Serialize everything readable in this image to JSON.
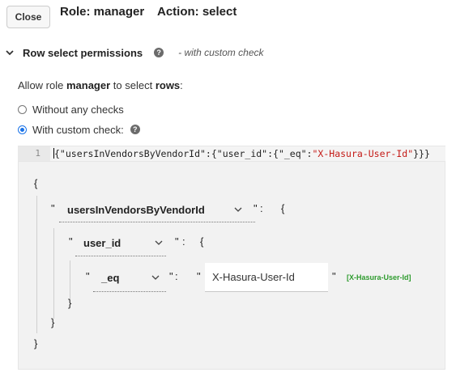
{
  "header": {
    "close_label": "Close",
    "role_text": "Role: manager",
    "action_text": "Action: select"
  },
  "section": {
    "title": "Row select permissions",
    "help_icon": "?",
    "note": "- with custom check"
  },
  "allow": {
    "prefix": "Allow role ",
    "role": "manager",
    "middle": " to select ",
    "target": "rows",
    "suffix": ":"
  },
  "options": [
    {
      "label": "Without any checks",
      "selected": false
    },
    {
      "label": "With custom check:",
      "selected": true
    }
  ],
  "code": {
    "line_number": "1",
    "part1": "{\"usersInVendorsByVendorId\":{\"user_id\":{\"_eq\":",
    "string_value": "\"X-Hasura-User-Id\"",
    "part2": "}}}"
  },
  "builder": {
    "open_brace": "{",
    "close_brace": "}",
    "quote": "\"",
    "colon": ":",
    "level1_key": "usersInVendorsByVendorId",
    "level2_key": "user_id",
    "level3_key": "_eq",
    "value": "X-Hasura-User-Id",
    "value_hint": "[X-Hasura-User-Id]"
  },
  "colors": {
    "accent": "#1a73e8",
    "string": "#c41a16",
    "hint_green": "#2e9b2e"
  }
}
